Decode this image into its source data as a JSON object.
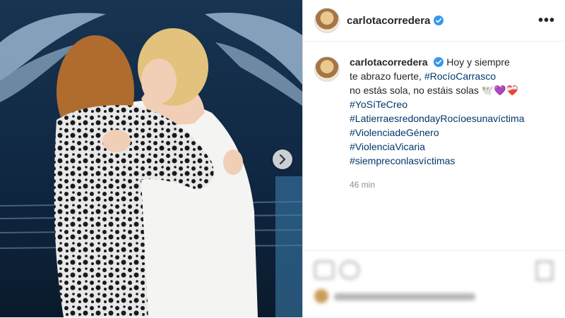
{
  "post": {
    "username": "carlotacorredera",
    "caption_lines": [
      "Hoy y siempre",
      "te abrazo fuerte,",
      "no estás sola, no estáis solas"
    ],
    "mention": "#RocíoCarrasco",
    "hashtags": [
      "#YoSíTeCreo",
      "#LatierraesredondayRocíoesunavíctima",
      "#ViolenciadeGénero",
      "#ViolenciaVicaria",
      "#siempreconlasvíctimas"
    ],
    "emojis": "🕊️💜❤️‍🩹",
    "time": "46 min"
  },
  "colors": {
    "verified": "#3897f0",
    "link": "#00376b",
    "muted": "#8e8e8e"
  },
  "icons": {
    "next": "chevron-right-icon",
    "more": "more-options-icon",
    "verified": "verified-badge-icon"
  }
}
